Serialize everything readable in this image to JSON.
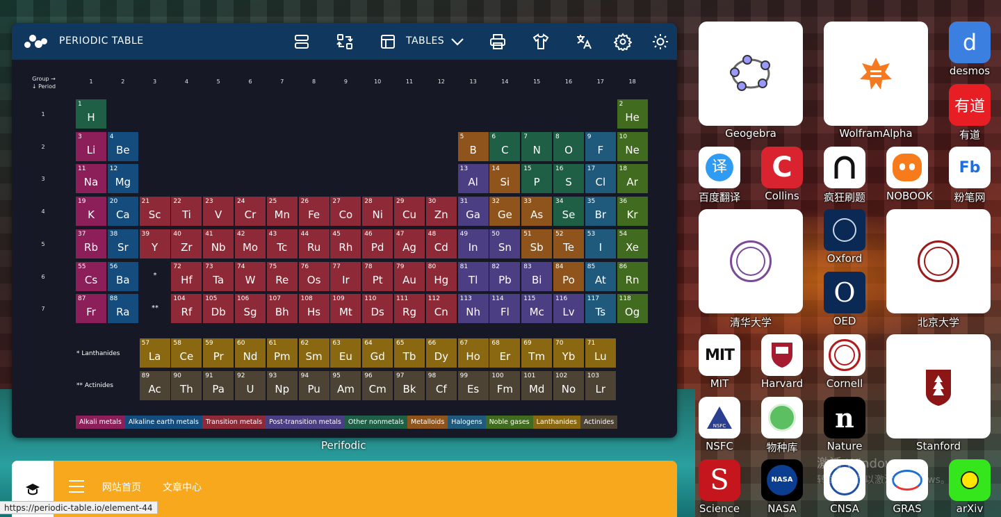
{
  "header": {
    "brand": "PERIODIC TABLE",
    "tables_label": "TABLES"
  },
  "axis": {
    "group_label": "Group →",
    "period_label": "↓ Period",
    "groups": [
      "1",
      "2",
      "3",
      "4",
      "5",
      "6",
      "7",
      "8",
      "9",
      "10",
      "11",
      "12",
      "13",
      "14",
      "15",
      "16",
      "17",
      "18"
    ],
    "periods": [
      "1",
      "2",
      "3",
      "4",
      "5",
      "6",
      "7"
    ]
  },
  "colors": {
    "alkali": "#8c1e5a",
    "alkaline": "#144d7d",
    "transition": "#8e2a37",
    "post": "#4b3e82",
    "nonmetal": "#1e5f45",
    "metalloid": "#8f541b",
    "halogen": "#1f5a7d",
    "noble": "#416b1e",
    "lanthanide": "#8a6811",
    "actinide": "#4c4335"
  },
  "elements": [
    {
      "n": "1",
      "s": "H",
      "g": 1,
      "p": 1,
      "c": "nonmetal"
    },
    {
      "n": "2",
      "s": "He",
      "g": 18,
      "p": 1,
      "c": "noble"
    },
    {
      "n": "3",
      "s": "Li",
      "g": 1,
      "p": 2,
      "c": "alkali"
    },
    {
      "n": "4",
      "s": "Be",
      "g": 2,
      "p": 2,
      "c": "alkaline"
    },
    {
      "n": "5",
      "s": "B",
      "g": 13,
      "p": 2,
      "c": "metalloid"
    },
    {
      "n": "6",
      "s": "C",
      "g": 14,
      "p": 2,
      "c": "nonmetal"
    },
    {
      "n": "7",
      "s": "N",
      "g": 15,
      "p": 2,
      "c": "nonmetal"
    },
    {
      "n": "8",
      "s": "O",
      "g": 16,
      "p": 2,
      "c": "nonmetal"
    },
    {
      "n": "9",
      "s": "F",
      "g": 17,
      "p": 2,
      "c": "halogen"
    },
    {
      "n": "10",
      "s": "Ne",
      "g": 18,
      "p": 2,
      "c": "noble"
    },
    {
      "n": "11",
      "s": "Na",
      "g": 1,
      "p": 3,
      "c": "alkali"
    },
    {
      "n": "12",
      "s": "Mg",
      "g": 2,
      "p": 3,
      "c": "alkaline"
    },
    {
      "n": "13",
      "s": "Al",
      "g": 13,
      "p": 3,
      "c": "post"
    },
    {
      "n": "14",
      "s": "Si",
      "g": 14,
      "p": 3,
      "c": "metalloid"
    },
    {
      "n": "15",
      "s": "P",
      "g": 15,
      "p": 3,
      "c": "nonmetal"
    },
    {
      "n": "16",
      "s": "S",
      "g": 16,
      "p": 3,
      "c": "nonmetal"
    },
    {
      "n": "17",
      "s": "Cl",
      "g": 17,
      "p": 3,
      "c": "halogen"
    },
    {
      "n": "18",
      "s": "Ar",
      "g": 18,
      "p": 3,
      "c": "noble"
    },
    {
      "n": "19",
      "s": "K",
      "g": 1,
      "p": 4,
      "c": "alkali"
    },
    {
      "n": "20",
      "s": "Ca",
      "g": 2,
      "p": 4,
      "c": "alkaline"
    },
    {
      "n": "21",
      "s": "Sc",
      "g": 3,
      "p": 4,
      "c": "transition"
    },
    {
      "n": "22",
      "s": "Ti",
      "g": 4,
      "p": 4,
      "c": "transition"
    },
    {
      "n": "23",
      "s": "V",
      "g": 5,
      "p": 4,
      "c": "transition"
    },
    {
      "n": "24",
      "s": "Cr",
      "g": 6,
      "p": 4,
      "c": "transition"
    },
    {
      "n": "25",
      "s": "Mn",
      "g": 7,
      "p": 4,
      "c": "transition"
    },
    {
      "n": "26",
      "s": "Fe",
      "g": 8,
      "p": 4,
      "c": "transition"
    },
    {
      "n": "27",
      "s": "Co",
      "g": 9,
      "p": 4,
      "c": "transition"
    },
    {
      "n": "28",
      "s": "Ni",
      "g": 10,
      "p": 4,
      "c": "transition"
    },
    {
      "n": "29",
      "s": "Cu",
      "g": 11,
      "p": 4,
      "c": "transition"
    },
    {
      "n": "30",
      "s": "Zn",
      "g": 12,
      "p": 4,
      "c": "transition"
    },
    {
      "n": "31",
      "s": "Ga",
      "g": 13,
      "p": 4,
      "c": "post"
    },
    {
      "n": "32",
      "s": "Ge",
      "g": 14,
      "p": 4,
      "c": "metalloid"
    },
    {
      "n": "33",
      "s": "As",
      "g": 15,
      "p": 4,
      "c": "metalloid"
    },
    {
      "n": "34",
      "s": "Se",
      "g": 16,
      "p": 4,
      "c": "nonmetal"
    },
    {
      "n": "35",
      "s": "Br",
      "g": 17,
      "p": 4,
      "c": "halogen"
    },
    {
      "n": "36",
      "s": "Kr",
      "g": 18,
      "p": 4,
      "c": "noble"
    },
    {
      "n": "37",
      "s": "Rb",
      "g": 1,
      "p": 5,
      "c": "alkali"
    },
    {
      "n": "38",
      "s": "Sr",
      "g": 2,
      "p": 5,
      "c": "alkaline"
    },
    {
      "n": "39",
      "s": "Y",
      "g": 3,
      "p": 5,
      "c": "transition"
    },
    {
      "n": "40",
      "s": "Zr",
      "g": 4,
      "p": 5,
      "c": "transition"
    },
    {
      "n": "41",
      "s": "Nb",
      "g": 5,
      "p": 5,
      "c": "transition"
    },
    {
      "n": "42",
      "s": "Mo",
      "g": 6,
      "p": 5,
      "c": "transition"
    },
    {
      "n": "43",
      "s": "Tc",
      "g": 7,
      "p": 5,
      "c": "transition"
    },
    {
      "n": "44",
      "s": "Ru",
      "g": 8,
      "p": 5,
      "c": "transition"
    },
    {
      "n": "45",
      "s": "Rh",
      "g": 9,
      "p": 5,
      "c": "transition"
    },
    {
      "n": "46",
      "s": "Pd",
      "g": 10,
      "p": 5,
      "c": "transition"
    },
    {
      "n": "47",
      "s": "Ag",
      "g": 11,
      "p": 5,
      "c": "transition"
    },
    {
      "n": "48",
      "s": "Cd",
      "g": 12,
      "p": 5,
      "c": "transition"
    },
    {
      "n": "49",
      "s": "In",
      "g": 13,
      "p": 5,
      "c": "post"
    },
    {
      "n": "50",
      "s": "Sn",
      "g": 14,
      "p": 5,
      "c": "post"
    },
    {
      "n": "51",
      "s": "Sb",
      "g": 15,
      "p": 5,
      "c": "metalloid"
    },
    {
      "n": "52",
      "s": "Te",
      "g": 16,
      "p": 5,
      "c": "metalloid"
    },
    {
      "n": "53",
      "s": "I",
      "g": 17,
      "p": 5,
      "c": "halogen"
    },
    {
      "n": "54",
      "s": "Xe",
      "g": 18,
      "p": 5,
      "c": "noble"
    },
    {
      "n": "55",
      "s": "Cs",
      "g": 1,
      "p": 6,
      "c": "alkali"
    },
    {
      "n": "56",
      "s": "Ba",
      "g": 2,
      "p": 6,
      "c": "alkaline"
    },
    {
      "n": "72",
      "s": "Hf",
      "g": 4,
      "p": 6,
      "c": "transition"
    },
    {
      "n": "73",
      "s": "Ta",
      "g": 5,
      "p": 6,
      "c": "transition"
    },
    {
      "n": "74",
      "s": "W",
      "g": 6,
      "p": 6,
      "c": "transition"
    },
    {
      "n": "75",
      "s": "Re",
      "g": 7,
      "p": 6,
      "c": "transition"
    },
    {
      "n": "76",
      "s": "Os",
      "g": 8,
      "p": 6,
      "c": "transition"
    },
    {
      "n": "77",
      "s": "Ir",
      "g": 9,
      "p": 6,
      "c": "transition"
    },
    {
      "n": "78",
      "s": "Pt",
      "g": 10,
      "p": 6,
      "c": "transition"
    },
    {
      "n": "79",
      "s": "Au",
      "g": 11,
      "p": 6,
      "c": "transition"
    },
    {
      "n": "80",
      "s": "Hg",
      "g": 12,
      "p": 6,
      "c": "transition"
    },
    {
      "n": "81",
      "s": "Tl",
      "g": 13,
      "p": 6,
      "c": "post"
    },
    {
      "n": "82",
      "s": "Pb",
      "g": 14,
      "p": 6,
      "c": "post"
    },
    {
      "n": "83",
      "s": "Bi",
      "g": 15,
      "p": 6,
      "c": "post"
    },
    {
      "n": "84",
      "s": "Po",
      "g": 16,
      "p": 6,
      "c": "metalloid"
    },
    {
      "n": "85",
      "s": "At",
      "g": 17,
      "p": 6,
      "c": "halogen"
    },
    {
      "n": "86",
      "s": "Rn",
      "g": 18,
      "p": 6,
      "c": "noble"
    },
    {
      "n": "87",
      "s": "Fr",
      "g": 1,
      "p": 7,
      "c": "alkali"
    },
    {
      "n": "88",
      "s": "Ra",
      "g": 2,
      "p": 7,
      "c": "alkaline"
    },
    {
      "n": "104",
      "s": "Rf",
      "g": 4,
      "p": 7,
      "c": "transition"
    },
    {
      "n": "105",
      "s": "Db",
      "g": 5,
      "p": 7,
      "c": "transition"
    },
    {
      "n": "106",
      "s": "Sg",
      "g": 6,
      "p": 7,
      "c": "transition"
    },
    {
      "n": "107",
      "s": "Bh",
      "g": 7,
      "p": 7,
      "c": "transition"
    },
    {
      "n": "108",
      "s": "Hs",
      "g": 8,
      "p": 7,
      "c": "transition"
    },
    {
      "n": "109",
      "s": "Mt",
      "g": 9,
      "p": 7,
      "c": "transition"
    },
    {
      "n": "110",
      "s": "Ds",
      "g": 10,
      "p": 7,
      "c": "transition"
    },
    {
      "n": "111",
      "s": "Rg",
      "g": 11,
      "p": 7,
      "c": "transition"
    },
    {
      "n": "112",
      "s": "Cn",
      "g": 12,
      "p": 7,
      "c": "transition"
    },
    {
      "n": "113",
      "s": "Nh",
      "g": 13,
      "p": 7,
      "c": "post"
    },
    {
      "n": "114",
      "s": "Fl",
      "g": 14,
      "p": 7,
      "c": "post"
    },
    {
      "n": "115",
      "s": "Mc",
      "g": 15,
      "p": 7,
      "c": "post"
    },
    {
      "n": "116",
      "s": "Lv",
      "g": 16,
      "p": 7,
      "c": "post"
    },
    {
      "n": "117",
      "s": "Ts",
      "g": 17,
      "p": 7,
      "c": "halogen"
    },
    {
      "n": "118",
      "s": "Og",
      "g": 18,
      "p": 7,
      "c": "noble"
    }
  ],
  "series_marks": {
    "lanthanide_mark": "*",
    "actinide_mark": "**"
  },
  "series_labels": {
    "lanthanides": "* Lanthanides",
    "actinides": "** Actinides"
  },
  "lanthanides": [
    {
      "n": "57",
      "s": "La"
    },
    {
      "n": "58",
      "s": "Ce"
    },
    {
      "n": "59",
      "s": "Pr"
    },
    {
      "n": "60",
      "s": "Nd"
    },
    {
      "n": "61",
      "s": "Pm"
    },
    {
      "n": "62",
      "s": "Sm"
    },
    {
      "n": "63",
      "s": "Eu"
    },
    {
      "n": "64",
      "s": "Gd"
    },
    {
      "n": "65",
      "s": "Tb"
    },
    {
      "n": "66",
      "s": "Dy"
    },
    {
      "n": "67",
      "s": "Ho"
    },
    {
      "n": "68",
      "s": "Er"
    },
    {
      "n": "69",
      "s": "Tm"
    },
    {
      "n": "70",
      "s": "Yb"
    },
    {
      "n": "71",
      "s": "Lu"
    }
  ],
  "actinides": [
    {
      "n": "89",
      "s": "Ac"
    },
    {
      "n": "90",
      "s": "Th"
    },
    {
      "n": "91",
      "s": "Pa"
    },
    {
      "n": "92",
      "s": "U"
    },
    {
      "n": "93",
      "s": "Np"
    },
    {
      "n": "94",
      "s": "Pu"
    },
    {
      "n": "95",
      "s": "Am"
    },
    {
      "n": "96",
      "s": "Cm"
    },
    {
      "n": "97",
      "s": "Bk"
    },
    {
      "n": "98",
      "s": "Cf"
    },
    {
      "n": "99",
      "s": "Es"
    },
    {
      "n": "100",
      "s": "Fm"
    },
    {
      "n": "101",
      "s": "Md"
    },
    {
      "n": "102",
      "s": "No"
    },
    {
      "n": "103",
      "s": "Lr"
    }
  ],
  "legend": [
    {
      "label": "Alkali metals",
      "c": "alkali"
    },
    {
      "label": "Alkaline earth metals",
      "c": "alkaline"
    },
    {
      "label": "Transition metals",
      "c": "transition"
    },
    {
      "label": "Post-transition metals",
      "c": "post"
    },
    {
      "label": "Other nonmetals",
      "c": "nonmetal"
    },
    {
      "label": "Metalloids",
      "c": "metalloid"
    },
    {
      "label": "Halogens",
      "c": "halogen"
    },
    {
      "label": "Noble gases",
      "c": "noble"
    },
    {
      "label": "Lanthanides",
      "c": "lanthanide"
    },
    {
      "label": "Actinides",
      "c": "actinide"
    }
  ],
  "perifodic_label": "Perifodic",
  "apps": {
    "geogebra": "Geogebra",
    "wolfram": "WolframAlpha",
    "desmos": "desmos",
    "youdao": "有道",
    "baidu": "百度翻译",
    "collins": "Collins",
    "fengkuang": "疯狂刷题",
    "nobook": "NOBOOK",
    "fenbi": "粉笔网",
    "tsinghua": "清华大学",
    "oxford": "Oxford",
    "oed": "OED",
    "pku": "北京大学",
    "mit": "MIT",
    "harvard": "Harvard",
    "cornell": "Cornell",
    "stanford": "Stanford",
    "nsfc": "NSFC",
    "wuzhongku": "物种库",
    "nature": "Nature",
    "science": "Science",
    "nasa": "NASA",
    "cnsa": "CNSA",
    "gras": "GRAS",
    "arxiv": "arXiv"
  },
  "bottom": {
    "nav1": "网站首页",
    "nav2": "文章中心"
  },
  "status_url": "https://periodic-table.io/element-44",
  "windows_watermark": {
    "line1": "激活 Windows",
    "line2": "转到\"设置\"以激活 Windows。"
  }
}
